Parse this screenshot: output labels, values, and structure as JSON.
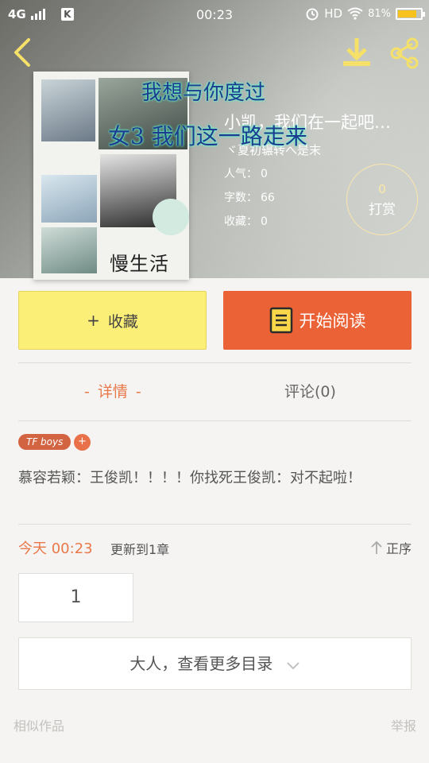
{
  "status_bar": {
    "network": "4G",
    "app_badge": "K",
    "time": "00:23",
    "hd": "HD",
    "battery_text": "81%",
    "battery_level": 0.81
  },
  "book": {
    "title": "小凯，我们在一起吧…",
    "author": "ヾ夏初辗转へ是末",
    "cover_title": "慢生活",
    "overlay_line1": "我想与你度过",
    "overlay_line2": "女3 我们这一路走来",
    "stats": {
      "popularity_label": "人气：",
      "popularity_value": "0",
      "word_count_label": "字数：",
      "word_count_value": "66",
      "favorites_label": "收藏：",
      "favorites_value": "0"
    },
    "tip": {
      "count": "0",
      "label": "打赏"
    }
  },
  "actions": {
    "favorite_label": "收藏",
    "favorite_plus": "+",
    "read_label": "开始阅读"
  },
  "tabs": {
    "detail_label": "详情",
    "detail_dash": "-",
    "comments_label": "评论(0)"
  },
  "details": {
    "tag": "TF boys",
    "tag_add": "+",
    "summary": "慕容若颖：王俊凯！！！！你找死王俊凯：对不起啦！"
  },
  "update": {
    "date": "今天 00:23",
    "text": "更新到1章",
    "sort_label": "正序"
  },
  "chapters": {
    "first_chapter": "1",
    "more_label": "大人，查看更多目录"
  },
  "footer": {
    "similar_works": "相似作品",
    "report": "举报"
  },
  "colors": {
    "accent": "#ea6236",
    "favorite_bg": "#fbef77",
    "highlight_text": "#e9784a"
  }
}
